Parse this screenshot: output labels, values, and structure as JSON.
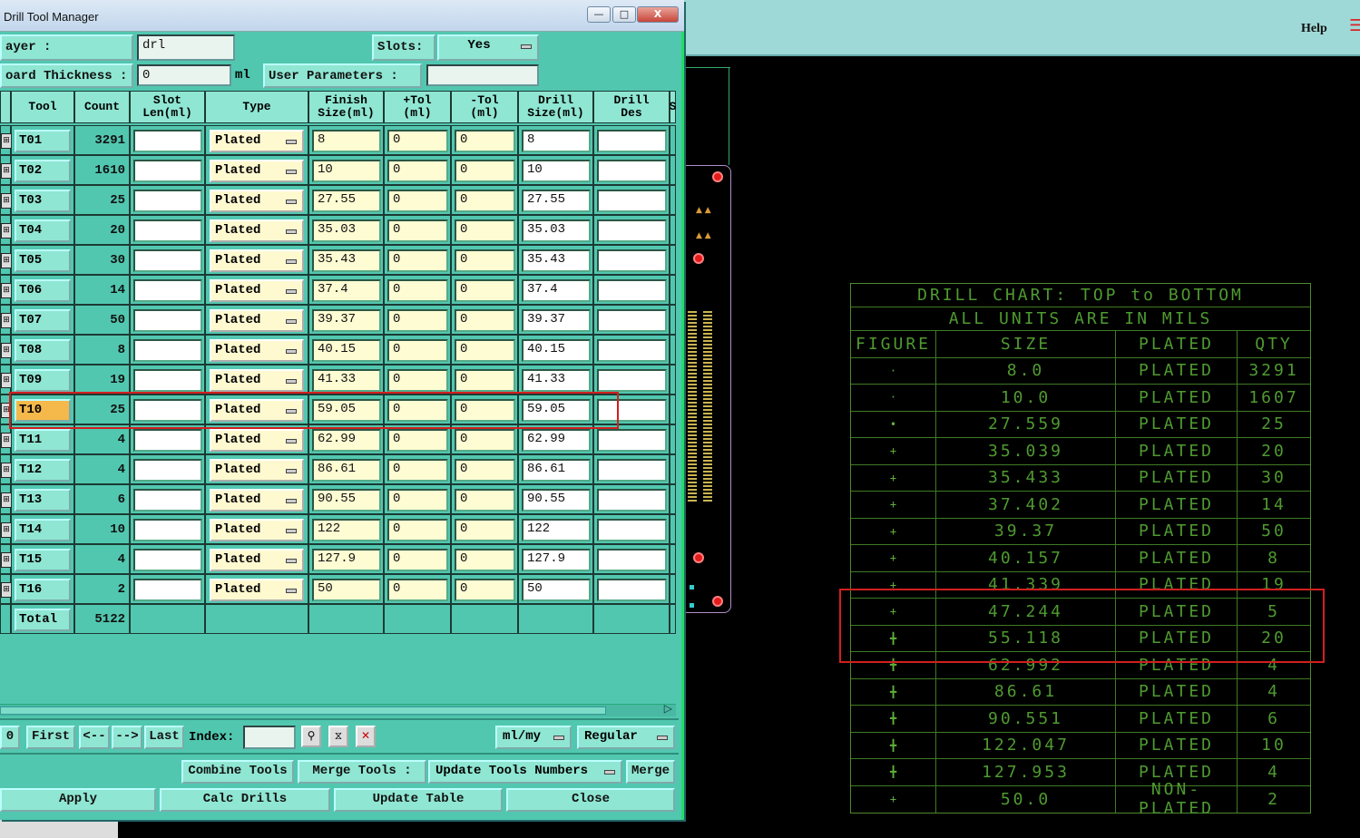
{
  "background": {
    "help_label": "Help",
    "drill_chart": {
      "title": "DRILL CHART: TOP to BOTTOM",
      "subtitle": "ALL UNITS ARE IN MILS",
      "headers": [
        "FIGURE",
        "SIZE",
        "PLATED",
        "QTY"
      ],
      "rows": [
        {
          "size": "8.0",
          "plated": "PLATED",
          "qty": "3291"
        },
        {
          "size": "10.0",
          "plated": "PLATED",
          "qty": "1607"
        },
        {
          "size": "27.559",
          "plated": "PLATED",
          "qty": "25"
        },
        {
          "size": "35.039",
          "plated": "PLATED",
          "qty": "20"
        },
        {
          "size": "35.433",
          "plated": "PLATED",
          "qty": "30"
        },
        {
          "size": "37.402",
          "plated": "PLATED",
          "qty": "14"
        },
        {
          "size": "39.37",
          "plated": "PLATED",
          "qty": "50"
        },
        {
          "size": "40.157",
          "plated": "PLATED",
          "qty": "8"
        },
        {
          "size": "41.339",
          "plated": "PLATED",
          "qty": "19"
        },
        {
          "size": "47.244",
          "plated": "PLATED",
          "qty": "5"
        },
        {
          "size": "55.118",
          "plated": "PLATED",
          "qty": "20"
        },
        {
          "size": "62.992",
          "plated": "PLATED",
          "qty": "4"
        },
        {
          "size": "86.61",
          "plated": "PLATED",
          "qty": "4"
        },
        {
          "size": "90.551",
          "plated": "PLATED",
          "qty": "6"
        },
        {
          "size": "122.047",
          "plated": "PLATED",
          "qty": "10"
        },
        {
          "size": "127.953",
          "plated": "PLATED",
          "qty": "4"
        },
        {
          "size": "50.0",
          "plated": "NON-PLATED",
          "qty": "2"
        }
      ]
    }
  },
  "dialog": {
    "title": "Drill Tool Manager",
    "window_buttons": {
      "minimize": "—",
      "maximize": "□",
      "close": "X"
    },
    "layer_label": "ayer :",
    "layer_value": "drl",
    "slots_label": "Slots:",
    "slots_value": "Yes",
    "board_thickness_label": "oard Thickness :",
    "board_thickness_value": "0",
    "board_thickness_unit": "ml",
    "user_params_label": "User Parameters :",
    "columns": [
      "Tool",
      "Count",
      "Slot\nLen(ml)",
      "Type",
      "Finish\nSize(ml)",
      "+Tol\n(ml)",
      "-Tol\n(ml)",
      "Drill\nSize(ml)",
      "Drill\nDes",
      "S"
    ],
    "rows": [
      {
        "tool": "T01",
        "count": "3291",
        "type": "Plated",
        "finish": "8",
        "ptol": "0",
        "ntol": "0",
        "drill": "8"
      },
      {
        "tool": "T02",
        "count": "1610",
        "type": "Plated",
        "finish": "10",
        "ptol": "0",
        "ntol": "0",
        "drill": "10"
      },
      {
        "tool": "T03",
        "count": "25",
        "type": "Plated",
        "finish": "27.55",
        "ptol": "0",
        "ntol": "0",
        "drill": "27.55"
      },
      {
        "tool": "T04",
        "count": "20",
        "type": "Plated",
        "finish": "35.03",
        "ptol": "0",
        "ntol": "0",
        "drill": "35.03"
      },
      {
        "tool": "T05",
        "count": "30",
        "type": "Plated",
        "finish": "35.43",
        "ptol": "0",
        "ntol": "0",
        "drill": "35.43"
      },
      {
        "tool": "T06",
        "count": "14",
        "type": "Plated",
        "finish": "37.4",
        "ptol": "0",
        "ntol": "0",
        "drill": "37.4"
      },
      {
        "tool": "T07",
        "count": "50",
        "type": "Plated",
        "finish": "39.37",
        "ptol": "0",
        "ntol": "0",
        "drill": "39.37"
      },
      {
        "tool": "T08",
        "count": "8",
        "type": "Plated",
        "finish": "40.15",
        "ptol": "0",
        "ntol": "0",
        "drill": "40.15"
      },
      {
        "tool": "T09",
        "count": "19",
        "type": "Plated",
        "finish": "41.33",
        "ptol": "0",
        "ntol": "0",
        "drill": "41.33"
      },
      {
        "tool": "T10",
        "count": "25",
        "type": "Plated",
        "finish": "59.05",
        "ptol": "0",
        "ntol": "0",
        "drill": "59.05",
        "selected": true
      },
      {
        "tool": "T11",
        "count": "4",
        "type": "Plated",
        "finish": "62.99",
        "ptol": "0",
        "ntol": "0",
        "drill": "62.99"
      },
      {
        "tool": "T12",
        "count": "4",
        "type": "Plated",
        "finish": "86.61",
        "ptol": "0",
        "ntol": "0",
        "drill": "86.61"
      },
      {
        "tool": "T13",
        "count": "6",
        "type": "Plated",
        "finish": "90.55",
        "ptol": "0",
        "ntol": "0",
        "drill": "90.55"
      },
      {
        "tool": "T14",
        "count": "10",
        "type": "Plated",
        "finish": "122",
        "ptol": "0",
        "ntol": "0",
        "drill": "122"
      },
      {
        "tool": "T15",
        "count": "4",
        "type": "Plated",
        "finish": "127.9",
        "ptol": "0",
        "ntol": "0",
        "drill": "127.9"
      },
      {
        "tool": "T16",
        "count": "2",
        "type": "Plated",
        "finish": "50",
        "ptol": "0",
        "ntol": "0",
        "drill": "50"
      }
    ],
    "total_label": "Total",
    "total_value": "5122",
    "nav": {
      "page": "0",
      "first": "First",
      "prev": "<--",
      "next": "-->",
      "last": "Last",
      "index_label": "Index:",
      "units": "ml/my",
      "mode": "Regular"
    },
    "actions": {
      "combine_tools": "Combine Tools",
      "merge_tools_label": "Merge Tools :",
      "update_tools_numbers": "Update Tools Numbers",
      "merge": "Merge",
      "apply": "Apply",
      "calc_drills": "Calc Drills",
      "update_table": "Update Table",
      "close": "Close"
    },
    "colors": {
      "panel": "#52c7b0",
      "selected_tool": "#f5b84a",
      "highlight": "#d21f1f"
    }
  }
}
